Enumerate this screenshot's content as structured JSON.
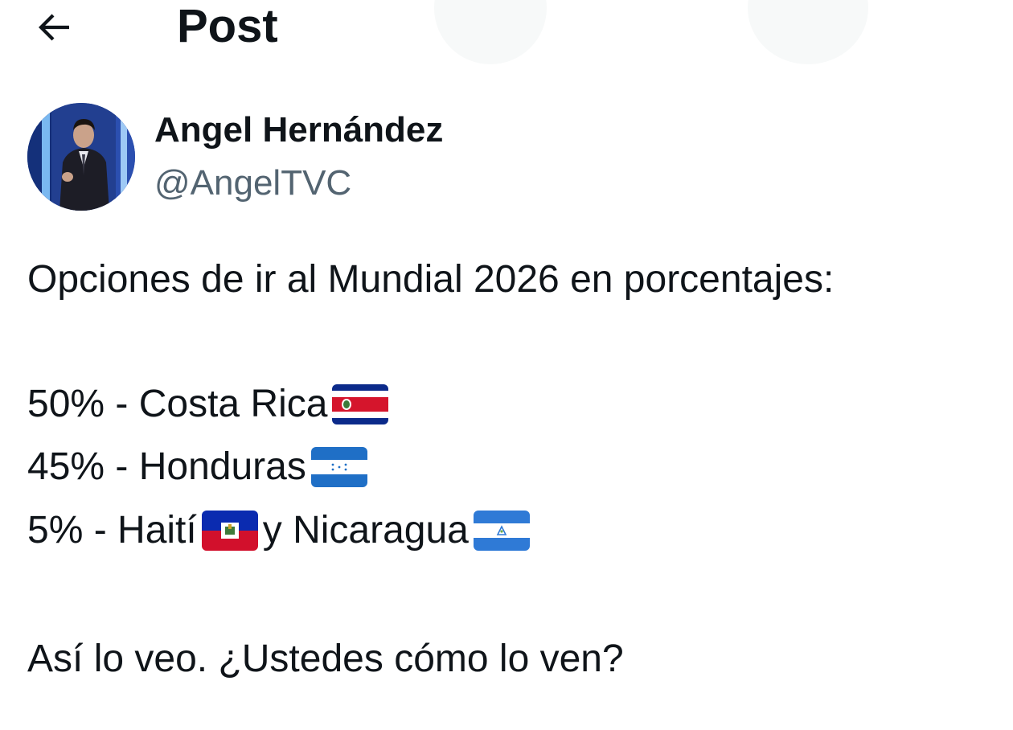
{
  "header": {
    "title": "Post",
    "back_icon": "arrow-left-icon"
  },
  "author": {
    "name": "Angel Hernández",
    "handle": "@AngelTVC",
    "avatar": "avatar-photo"
  },
  "tweet": {
    "line1": "Opciones de ir al Mundial 2026 en porcentajes:",
    "costa_rica": {
      "text": "50% - Costa Rica",
      "flag": "costa-rica-flag"
    },
    "honduras": {
      "text": "45% - Honduras",
      "flag": "honduras-flag"
    },
    "haiti": {
      "text": "5% - Haití",
      "flag": "haiti-flag"
    },
    "nicaragua": {
      "connector": "y Nicaragua",
      "flag": "nicaragua-flag"
    },
    "closing": "Así lo veo. ¿Ustedes cómo lo ven?"
  },
  "colors": {
    "text": "#0f1419",
    "secondary": "#536471"
  }
}
